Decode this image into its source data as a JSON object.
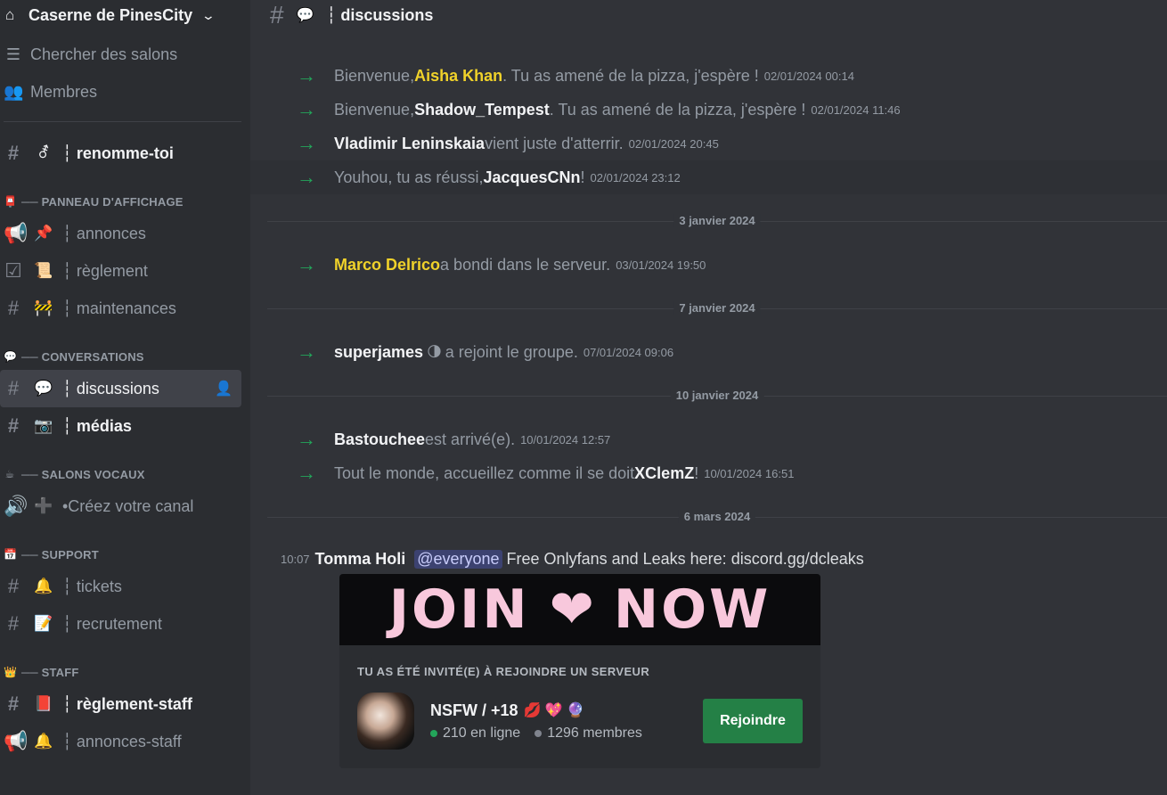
{
  "server": {
    "name": "Caserne de PinesCity"
  },
  "sidebar": {
    "utils": [
      {
        "label": "Chercher des salons"
      },
      {
        "label": "Membres"
      }
    ],
    "top_channel": {
      "emoji": "⚦",
      "label": "┆ renomme-toi"
    },
    "categories": [
      {
        "emoji": "📮",
        "label": "── PANNEAU D'AFFICHAGE",
        "channels": [
          {
            "emoji": "📌",
            "label": "┆ annonces"
          },
          {
            "emoji": "📜",
            "label": "┆ règlement"
          },
          {
            "emoji": "🚧",
            "label": "┆ maintenances"
          }
        ]
      },
      {
        "emoji": "💬",
        "label": "── CONVERSATIONS",
        "channels": [
          {
            "emoji": "💬",
            "label": "┆ discussions"
          },
          {
            "emoji": "📷",
            "label": "┆ médias"
          }
        ]
      },
      {
        "emoji": "☕",
        "label": "── SALONS VOCAUX",
        "channels": [
          {
            "emoji": "➕",
            "label": "•Créez votre canal"
          }
        ]
      },
      {
        "emoji": "📅",
        "label": "── SUPPORT",
        "channels": [
          {
            "emoji": "🔔",
            "label": "┆ tickets"
          },
          {
            "emoji": "📝",
            "label": "┆ recrutement"
          }
        ]
      },
      {
        "emoji": "👑",
        "label": "── STAFF",
        "channels": [
          {
            "emoji": "📕",
            "label": "┆ règlement-staff"
          },
          {
            "emoji": "🔔",
            "label": "┆ annonces-staff"
          }
        ]
      }
    ]
  },
  "header": {
    "title": "┆ discussions",
    "emoji": "💬"
  },
  "messages": {
    "group1": [
      {
        "pre": "Bienvenue, ",
        "user": "Aisha Khan",
        "post": ". Tu as amené de la pizza, j'espère !",
        "ts": "02/01/2024 00:14"
      },
      {
        "pre": "Bienvenue, ",
        "user": "Shadow_Tempest",
        "post": ". Tu as amené de la pizza, j'espère !",
        "ts": "02/01/2024 11:46"
      },
      {
        "pre": "",
        "user": "Vladimir Leninskaia",
        "post": " vient juste d'atterrir.",
        "ts": "02/01/2024 20:45"
      },
      {
        "pre": "Youhou, tu as réussi, ",
        "user": "JacquesCNn",
        "post": " !",
        "ts": "02/01/2024 23:12"
      }
    ],
    "date2": "3 janvier 2024",
    "group2": {
      "user": "Marco Delrico",
      "post": " a bondi dans le serveur.",
      "ts": "03/01/2024 19:50"
    },
    "date3": "7 janvier 2024",
    "group3": {
      "user": "superjames",
      "post": " a rejoint le groupe.",
      "ts": "07/01/2024 09:06"
    },
    "date4": "10 janvier 2024",
    "group4": [
      {
        "pre": "",
        "user": "Bastouchee",
        "post": " est arrivé(e).",
        "ts": "10/01/2024 12:57"
      },
      {
        "pre": "Tout le monde, accueillez comme il se doit ",
        "user": "XClemZ",
        "post": " !",
        "ts": "10/01/2024 16:51"
      }
    ],
    "date5": "6 mars 2024",
    "last": {
      "ts": "10:07",
      "author": "Tomma Holi",
      "mention": "@everyone",
      "text": "Free Onlyfans and Leaks here: discord.gg/dcleaks"
    }
  },
  "invite": {
    "banner_left": "JOIN",
    "banner_right": "NOW",
    "title": "TU AS ÉTÉ INVITÉ(E) À REJOINDRE UN SERVEUR",
    "server_name": "NSFW / +18",
    "badges": "💋 💖 🔮",
    "online": "210 en ligne",
    "members": "1296 membres",
    "button": "Rejoindre"
  },
  "colors": {
    "accent_green": "#23a55a",
    "gold_user": "#f0d22a",
    "join_button": "#248046"
  }
}
